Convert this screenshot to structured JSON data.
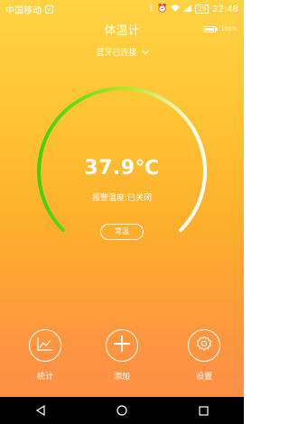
{
  "status_bar": {
    "carrier": "中国移动",
    "battery_percent": "25",
    "time": "22:48"
  },
  "header": {
    "title": "体温计",
    "device_battery": "100%",
    "device_battery_level": 1.0
  },
  "bluetooth": {
    "status": "蓝牙已连接"
  },
  "gauge": {
    "temperature": "37.9℃",
    "alarm_status": "报警温度:已关闭",
    "mode_label": "常温",
    "fill_fraction": 0.8,
    "colors": [
      "#40cf12",
      "#b8e62a",
      "#f1f6ba",
      "#ffffff"
    ]
  },
  "actions": [
    {
      "label": "统计",
      "icon": "chart-icon"
    },
    {
      "label": "添加",
      "icon": "plus-icon"
    },
    {
      "label": "设置",
      "icon": "gear-icon"
    }
  ],
  "nav": [
    "back-icon",
    "home-icon",
    "recents-icon"
  ]
}
